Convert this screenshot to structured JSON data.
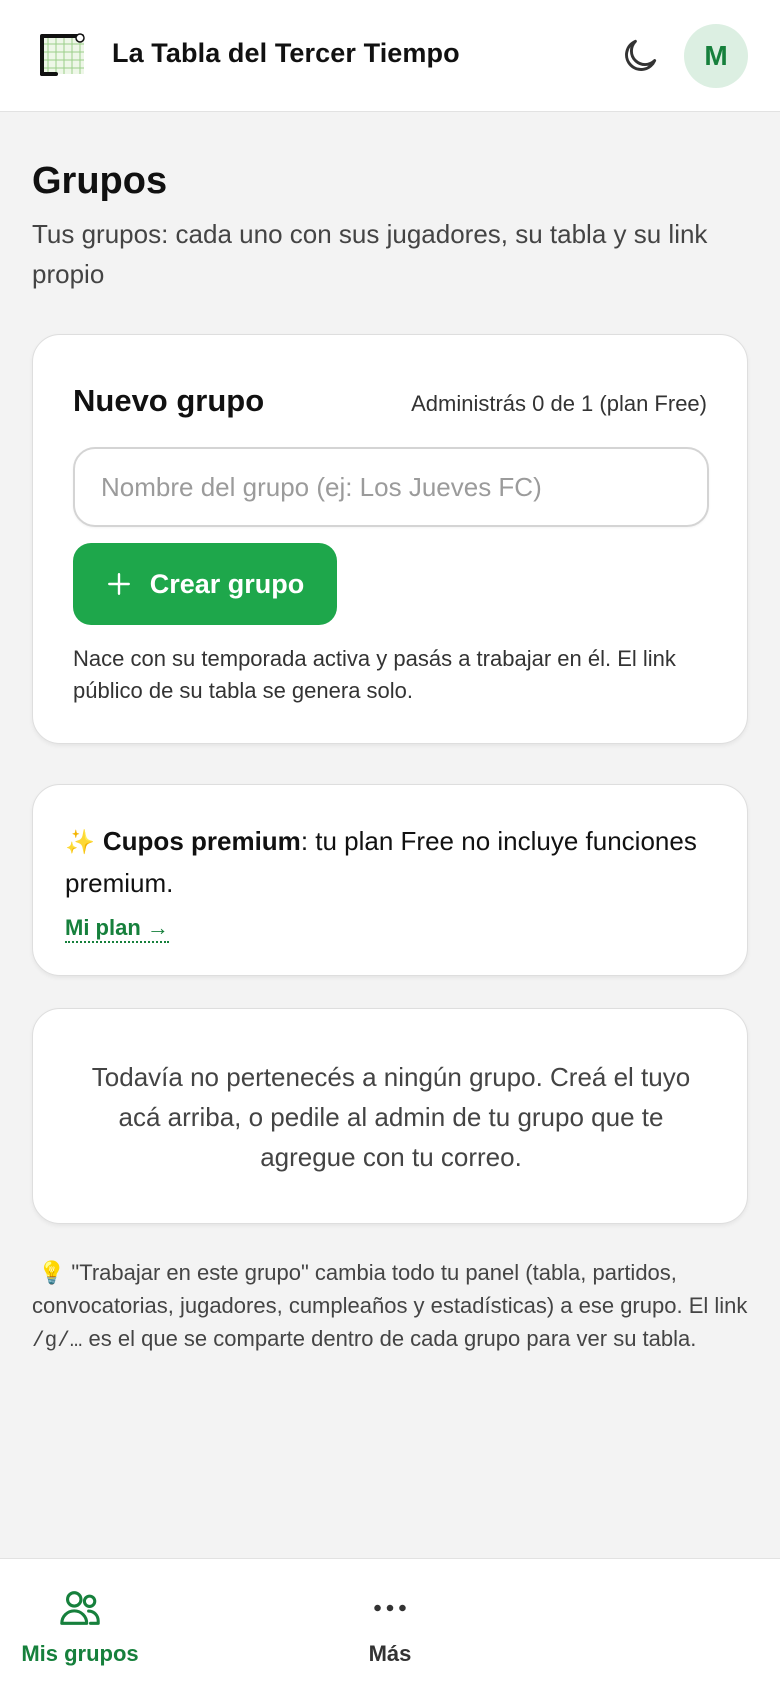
{
  "header": {
    "app_title": "La Tabla del Tercer Tiempo",
    "avatar_initial": "M",
    "logo_icon": "goal-net-icon",
    "theme_icon": "moon-icon"
  },
  "page": {
    "title": "Grupos",
    "subtitle": "Tus grupos: cada uno con sus jugadores, su tabla y su link propio"
  },
  "new_group": {
    "title": "Nuevo grupo",
    "quota": "Administrás 0 de 1 (plan Free)",
    "input_value": "",
    "input_placeholder": "Nombre del grupo (ej: Los Jueves FC)",
    "create_label": "Crear grupo",
    "help": "Nace con su temporada activa y pasás a trabajar en él. El link público de su tabla se genera solo."
  },
  "premium": {
    "icon": "✨",
    "title": "Cupos premium",
    "text": ": tu plan Free no incluye funciones premium.",
    "link_label": "Mi plan →"
  },
  "empty_state": {
    "text": "Todavía no pertenecés a ningún grupo. Creá el tuyo acá arriba, o pedile al admin de tu grupo que te agregue con tu correo."
  },
  "tip": {
    "icon": "💡",
    "text_before": "\"Trabajar en este grupo\" cambia todo tu panel (tabla, partidos, convocatorias, jugadores, cumpleaños y estadísticas) a ese grupo. El link ",
    "code": "/g/…",
    "text_after": " es el que se comparte dentro de cada grupo para ver su tabla."
  },
  "bottom_nav": {
    "items": [
      {
        "label": "Mis grupos",
        "icon": "users-icon",
        "active": true
      },
      {
        "label": "Más",
        "icon": "more-dots-icon",
        "active": false
      }
    ]
  },
  "colors": {
    "accent": "#1ea74b",
    "accent_text": "#16803c",
    "background": "#f3f3f3"
  }
}
